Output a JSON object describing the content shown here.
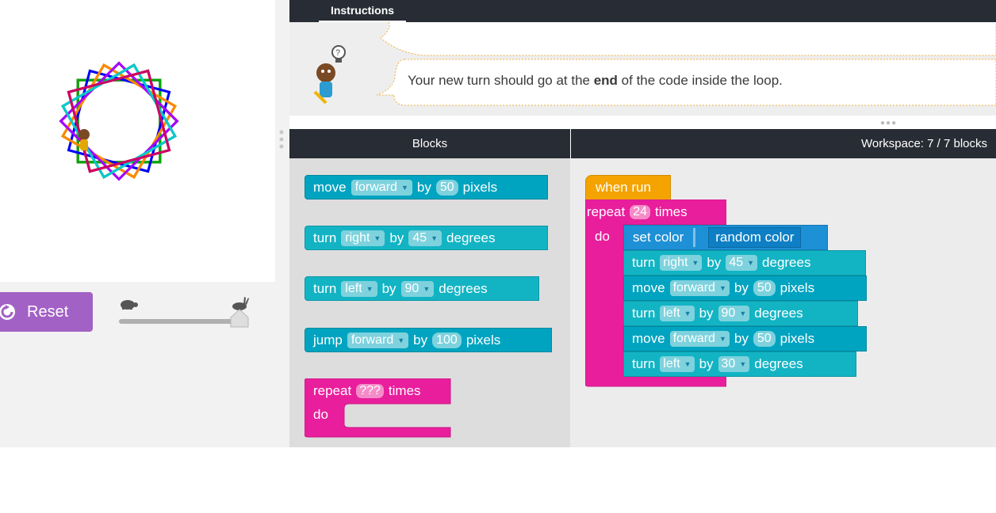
{
  "instructions": {
    "tab_label": "Instructions",
    "text_before": "Your new turn should go at the ",
    "text_bold": "end",
    "text_after": " of the code inside the loop."
  },
  "controls": {
    "reset_label": "Reset",
    "speed_level": 1.0
  },
  "blocks_panel": {
    "header": "Blocks",
    "toolbox": [
      {
        "kind": "move",
        "words": [
          "move",
          "by",
          "pixels"
        ],
        "dir": "forward",
        "value": "50"
      },
      {
        "kind": "turn",
        "words": [
          "turn",
          "by",
          "degrees"
        ],
        "dir": "right",
        "value": "45"
      },
      {
        "kind": "turn",
        "words": [
          "turn",
          "by",
          "degrees"
        ],
        "dir": "left",
        "value": "90"
      },
      {
        "kind": "jump",
        "words": [
          "jump",
          "by",
          "pixels"
        ],
        "dir": "forward",
        "value": "100"
      }
    ],
    "repeat_block": {
      "label_repeat": "repeat",
      "count": "???",
      "label_times": "times",
      "label_do": "do"
    }
  },
  "workspace": {
    "header": "Workspace: 7 / 7 blocks",
    "when_run": "when run",
    "repeat": {
      "label_repeat": "repeat",
      "count": "24",
      "label_times": "times",
      "label_do": "do"
    },
    "set_color": {
      "label": "set color",
      "value": "random color"
    },
    "steps": [
      {
        "word": "turn",
        "dir": "right",
        "by": "by",
        "value": "45",
        "unit": "degrees"
      },
      {
        "word": "move",
        "dir": "forward",
        "by": "by",
        "value": "50",
        "unit": "pixels"
      },
      {
        "word": "turn",
        "dir": "left",
        "by": "by",
        "value": "90",
        "unit": "degrees"
      },
      {
        "word": "move",
        "dir": "forward",
        "by": "by",
        "value": "50",
        "unit": "pixels"
      },
      {
        "word": "turn",
        "dir": "left",
        "by": "by",
        "value": "30",
        "unit": "degrees"
      }
    ]
  },
  "colors": {
    "header_bg": "#282c34",
    "motion_block": "#00a4c0",
    "loop_block": "#e91e9c",
    "event_block": "#f4a300",
    "reset_button": "#a261c4",
    "color_block": "#1e90d6"
  }
}
